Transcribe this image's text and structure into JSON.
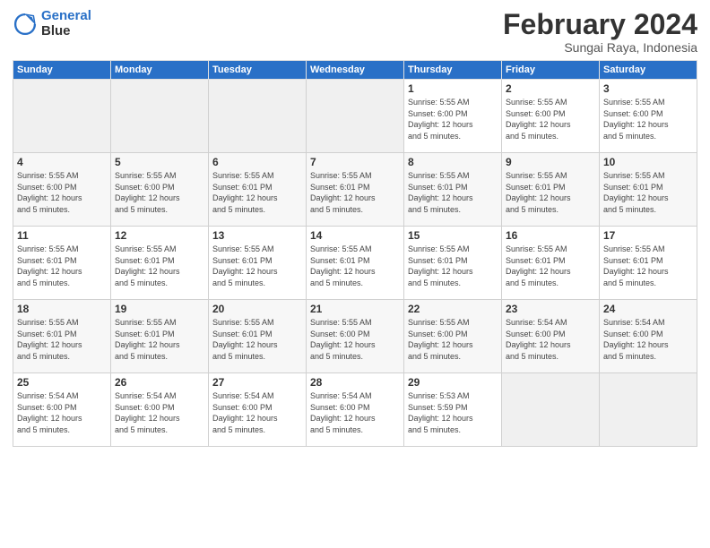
{
  "logo": {
    "line1": "General",
    "line2": "Blue"
  },
  "title": "February 2024",
  "subtitle": "Sungai Raya, Indonesia",
  "weekdays": [
    "Sunday",
    "Monday",
    "Tuesday",
    "Wednesday",
    "Thursday",
    "Friday",
    "Saturday"
  ],
  "weeks": [
    [
      {
        "day": "",
        "info": ""
      },
      {
        "day": "",
        "info": ""
      },
      {
        "day": "",
        "info": ""
      },
      {
        "day": "",
        "info": ""
      },
      {
        "day": "1",
        "info": "Sunrise: 5:55 AM\nSunset: 6:00 PM\nDaylight: 12 hours\nand 5 minutes."
      },
      {
        "day": "2",
        "info": "Sunrise: 5:55 AM\nSunset: 6:00 PM\nDaylight: 12 hours\nand 5 minutes."
      },
      {
        "day": "3",
        "info": "Sunrise: 5:55 AM\nSunset: 6:00 PM\nDaylight: 12 hours\nand 5 minutes."
      }
    ],
    [
      {
        "day": "4",
        "info": "Sunrise: 5:55 AM\nSunset: 6:00 PM\nDaylight: 12 hours\nand 5 minutes."
      },
      {
        "day": "5",
        "info": "Sunrise: 5:55 AM\nSunset: 6:00 PM\nDaylight: 12 hours\nand 5 minutes."
      },
      {
        "day": "6",
        "info": "Sunrise: 5:55 AM\nSunset: 6:01 PM\nDaylight: 12 hours\nand 5 minutes."
      },
      {
        "day": "7",
        "info": "Sunrise: 5:55 AM\nSunset: 6:01 PM\nDaylight: 12 hours\nand 5 minutes."
      },
      {
        "day": "8",
        "info": "Sunrise: 5:55 AM\nSunset: 6:01 PM\nDaylight: 12 hours\nand 5 minutes."
      },
      {
        "day": "9",
        "info": "Sunrise: 5:55 AM\nSunset: 6:01 PM\nDaylight: 12 hours\nand 5 minutes."
      },
      {
        "day": "10",
        "info": "Sunrise: 5:55 AM\nSunset: 6:01 PM\nDaylight: 12 hours\nand 5 minutes."
      }
    ],
    [
      {
        "day": "11",
        "info": "Sunrise: 5:55 AM\nSunset: 6:01 PM\nDaylight: 12 hours\nand 5 minutes."
      },
      {
        "day": "12",
        "info": "Sunrise: 5:55 AM\nSunset: 6:01 PM\nDaylight: 12 hours\nand 5 minutes."
      },
      {
        "day": "13",
        "info": "Sunrise: 5:55 AM\nSunset: 6:01 PM\nDaylight: 12 hours\nand 5 minutes."
      },
      {
        "day": "14",
        "info": "Sunrise: 5:55 AM\nSunset: 6:01 PM\nDaylight: 12 hours\nand 5 minutes."
      },
      {
        "day": "15",
        "info": "Sunrise: 5:55 AM\nSunset: 6:01 PM\nDaylight: 12 hours\nand 5 minutes."
      },
      {
        "day": "16",
        "info": "Sunrise: 5:55 AM\nSunset: 6:01 PM\nDaylight: 12 hours\nand 5 minutes."
      },
      {
        "day": "17",
        "info": "Sunrise: 5:55 AM\nSunset: 6:01 PM\nDaylight: 12 hours\nand 5 minutes."
      }
    ],
    [
      {
        "day": "18",
        "info": "Sunrise: 5:55 AM\nSunset: 6:01 PM\nDaylight: 12 hours\nand 5 minutes."
      },
      {
        "day": "19",
        "info": "Sunrise: 5:55 AM\nSunset: 6:01 PM\nDaylight: 12 hours\nand 5 minutes."
      },
      {
        "day": "20",
        "info": "Sunrise: 5:55 AM\nSunset: 6:01 PM\nDaylight: 12 hours\nand 5 minutes."
      },
      {
        "day": "21",
        "info": "Sunrise: 5:55 AM\nSunset: 6:00 PM\nDaylight: 12 hours\nand 5 minutes."
      },
      {
        "day": "22",
        "info": "Sunrise: 5:55 AM\nSunset: 6:00 PM\nDaylight: 12 hours\nand 5 minutes."
      },
      {
        "day": "23",
        "info": "Sunrise: 5:54 AM\nSunset: 6:00 PM\nDaylight: 12 hours\nand 5 minutes."
      },
      {
        "day": "24",
        "info": "Sunrise: 5:54 AM\nSunset: 6:00 PM\nDaylight: 12 hours\nand 5 minutes."
      }
    ],
    [
      {
        "day": "25",
        "info": "Sunrise: 5:54 AM\nSunset: 6:00 PM\nDaylight: 12 hours\nand 5 minutes."
      },
      {
        "day": "26",
        "info": "Sunrise: 5:54 AM\nSunset: 6:00 PM\nDaylight: 12 hours\nand 5 minutes."
      },
      {
        "day": "27",
        "info": "Sunrise: 5:54 AM\nSunset: 6:00 PM\nDaylight: 12 hours\nand 5 minutes."
      },
      {
        "day": "28",
        "info": "Sunrise: 5:54 AM\nSunset: 6:00 PM\nDaylight: 12 hours\nand 5 minutes."
      },
      {
        "day": "29",
        "info": "Sunrise: 5:53 AM\nSunset: 5:59 PM\nDaylight: 12 hours\nand 5 minutes."
      },
      {
        "day": "",
        "info": ""
      },
      {
        "day": "",
        "info": ""
      }
    ]
  ]
}
